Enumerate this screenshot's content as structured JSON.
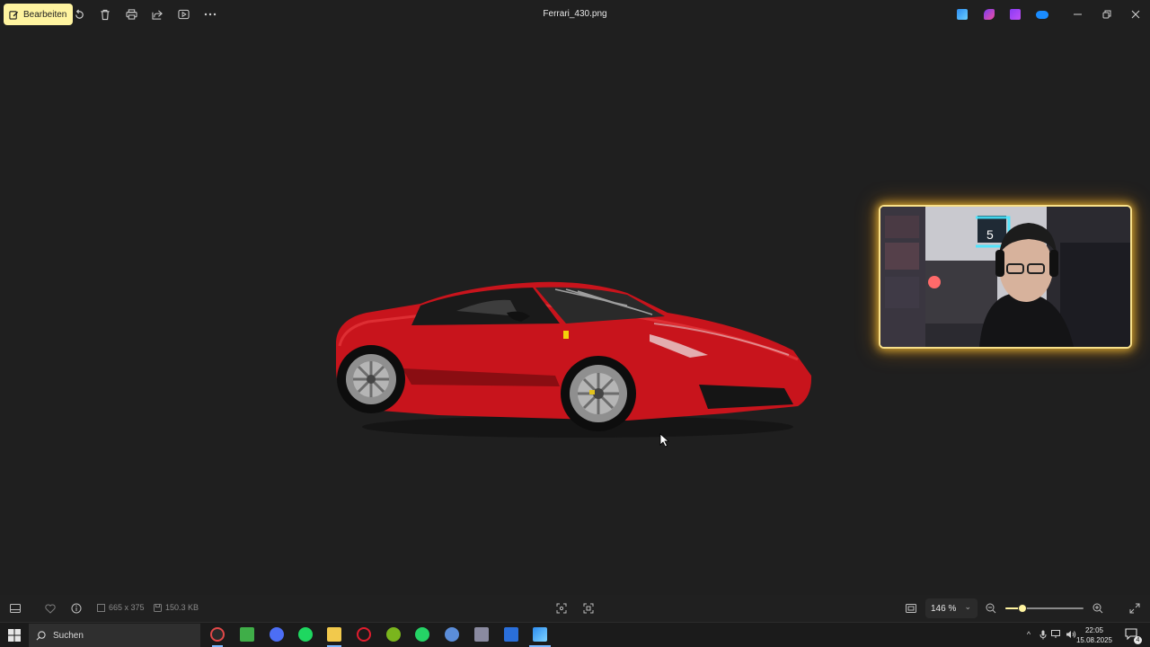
{
  "titlebar": {
    "edit_label": "Bearbeiten",
    "file_name": "Ferrari_430.png",
    "accent_color": "#fff4a0",
    "tools": [
      "rotate-icon",
      "delete-icon",
      "print-icon",
      "share-icon",
      "slideshow-icon",
      "more-icon"
    ],
    "app_icons": [
      "designer-icon",
      "clipchamp-icon",
      "clipchamp-video-icon",
      "onedrive-icon"
    ],
    "window_controls": [
      "minimize",
      "restore",
      "close"
    ]
  },
  "viewer": {
    "image_description": "red Ferrari sports car",
    "webcam_overlay": "streamer webcam with glowing frame"
  },
  "bottombar": {
    "dimensions": "665 x 375",
    "file_size": "150.3 KB",
    "zoom_value": "146 %",
    "zoom_level_fraction": 0.22
  },
  "taskbar": {
    "search_placeholder": "Suchen",
    "time": "22:05",
    "date": "15.08.2025",
    "notification_count": "4"
  }
}
